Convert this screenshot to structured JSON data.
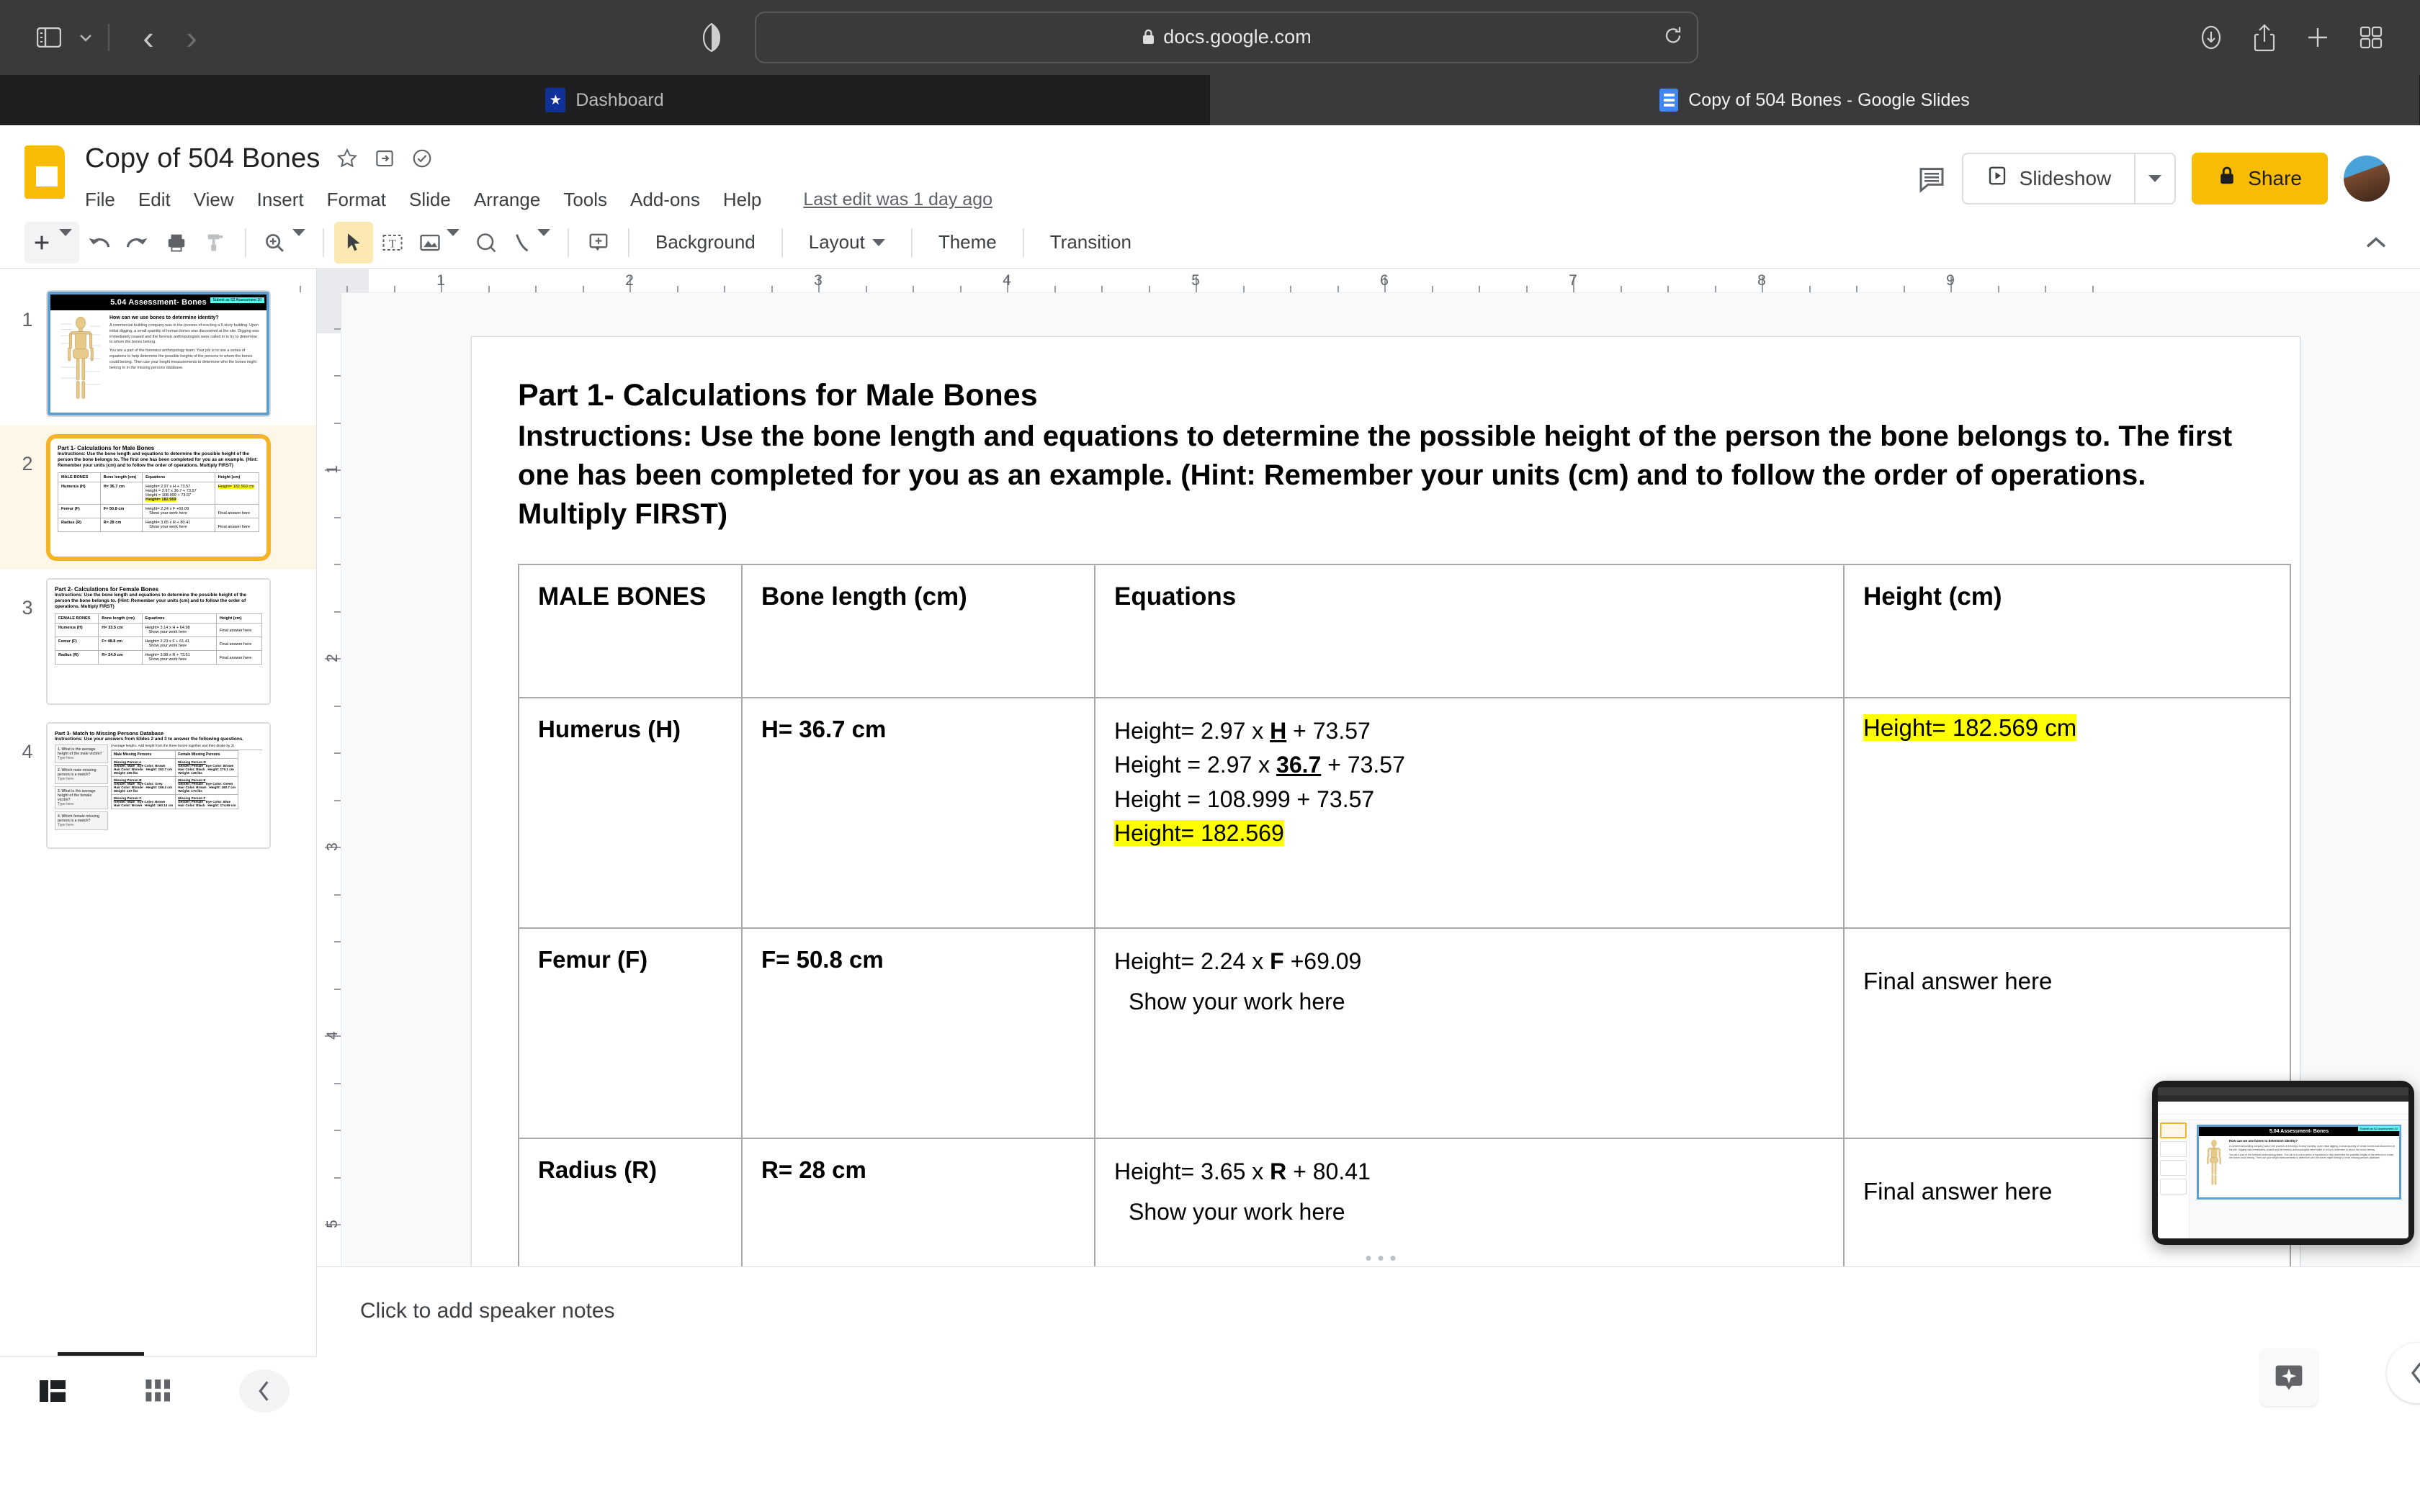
{
  "browser": {
    "url": "docs.google.com",
    "lock_icon": "lock-icon",
    "tabs": [
      {
        "label": "Dashboard",
        "favicon": "shield-star-icon",
        "active": false
      },
      {
        "label": "Copy of 504 Bones - Google Slides",
        "favicon": "google-slides-icon",
        "active": true
      }
    ],
    "toolbar_icons": [
      "sidebar-toggle-icon",
      "chevron-down-icon",
      "back-icon",
      "forward-icon",
      "shield-icon",
      "reload-icon",
      "downloads-icon",
      "share-icon",
      "new-tab-icon",
      "tab-overview-icon"
    ]
  },
  "app": {
    "title": "Copy of 504 Bones",
    "title_icons": [
      "star-icon",
      "move-to-folder-icon",
      "cloud-saved-icon"
    ],
    "menus": [
      "File",
      "Edit",
      "View",
      "Insert",
      "Format",
      "Slide",
      "Arrange",
      "Tools",
      "Add-ons",
      "Help"
    ],
    "last_edit": "Last edit was 1 day ago",
    "comments_label": "comment-history-icon",
    "slideshow_label": "Slideshow",
    "share_label": "Share",
    "share_lock_icon": "lock-icon",
    "avatar": "user-avatar",
    "accent_yellow": "#f9bc04",
    "selection_orange": "#f5b428",
    "highlight_yellow": "#ffff00"
  },
  "toolbar": {
    "new_slide": "new-slide-icon",
    "undo": "undo-icon",
    "redo": "redo-icon",
    "print": "print-icon",
    "paint_format": "paint-format-icon",
    "zoom": "zoom-icon",
    "select": "select-cursor-icon",
    "textbox": "text-box-icon",
    "image": "image-icon",
    "shape": "shape-icon",
    "line": "line-icon",
    "comment": "add-comment-icon",
    "background_label": "Background",
    "layout_label": "Layout",
    "theme_label": "Theme",
    "transition_label": "Transition",
    "collapse_icon": "chevron-up-icon"
  },
  "rulers": {
    "horizontal": [
      "1",
      "2",
      "3",
      "4",
      "5",
      "6",
      "7",
      "8",
      "9"
    ],
    "vertical": [
      "1",
      "2",
      "3",
      "4",
      "5"
    ]
  },
  "filmstrip": {
    "slides": [
      {
        "number": "1",
        "selected": false,
        "kind": "title",
        "badge": "Submit as S2 Assessment 10",
        "title": "5.04 Assessment- Bones",
        "question": "How can we use bones to determine identity?",
        "paragraphs": [
          "A commercial building company was in the process of erecting a 5-story building. Upon initial digging, a small quantity of human bones was discovered at the site. Digging was immediately ceased and the forensic anthropologists were called in to try to determine to whom the bones belong.",
          "You are a part of the forensics anthropology team. Your job is to use a series of equations to help determine the possible heights of the persons to whom the bones could belong. Then use your height measurements to determine who the bones might belong to in the missing persons database."
        ]
      },
      {
        "number": "2",
        "selected": true,
        "kind": "male",
        "title": "Part 1- Calculations for Male Bones",
        "instructions": "Instructions: Use the bone length and equations to determine the possible height of the person the bone belongs to. The first one has been completed for you as an example. (Hint: Remember your units (cm) and to follow the order of operations. Multiply FIRST)",
        "headers": [
          "MALE BONES",
          "Bone length (cm)",
          "Equations",
          "Height (cm)"
        ],
        "rows": [
          {
            "bone": "Humerus (H)",
            "length": "H= 36.7 cm",
            "eq_lines": [
              "Height= 2.97 x H + 73.57",
              "Height = 2.97 x 36.7 + 73.57",
              "Height = 108.999 + 73.57",
              "Height= 182.569"
            ],
            "height": "Height= 182.569 cm"
          },
          {
            "bone": "Femur (F)",
            "length": "F= 50.8 cm",
            "eq_lines": [
              "Height= 2.24 x F +69.09",
              "Show your work here"
            ],
            "height": "Final answer here"
          },
          {
            "bone": "Radius (R)",
            "length": "R= 28 cm",
            "eq_lines": [
              "Height= 3.65 x R + 80.41",
              "Show your work here"
            ],
            "height": "Final answer here"
          }
        ]
      },
      {
        "number": "3",
        "selected": false,
        "kind": "female",
        "title": "Part 2- Calculations for Female Bones",
        "instructions": "Instructions: Use the bone length and equations to determine the possible height of the person the bone belongs to. (Hint: Remember your units (cm) and to follow the order of operations. Multiply FIRST)",
        "headers": [
          "FEMALE BONES",
          "Bone length (cm)",
          "Equations",
          "Height (cm)"
        ],
        "rows": [
          {
            "bone": "Humerus (H)",
            "length": "H= 33.5 cm",
            "eq": "Height= 3.14 x H + 64.98",
            "work": "Show your work here",
            "height": "Final answer here"
          },
          {
            "bone": "Femur (F)",
            "length": "F= 48.8 cm",
            "eq": "Height= 2.23 x F + 61.41",
            "work": "Show your work here",
            "height": "Final answer here"
          },
          {
            "bone": "Radius (R)",
            "length": "R= 24.9 cm",
            "eq": "Height= 3.88 x R + 73.51",
            "work": "Show your work here",
            "height": "Final answer here"
          }
        ]
      },
      {
        "number": "4",
        "selected": false,
        "kind": "match",
        "title": "Part 3- Match to Missing Persons Database",
        "instructions": "Instructions: Use your answers from Slides 2 and 3 to answer the following questions.",
        "note": "(Average height= Add height from the three bones together and then divide by 3)",
        "questions": [
          {
            "q": "1. What is the average height of the male victim?",
            "a": "Type here"
          },
          {
            "q": "2. Which male missing person is a match?",
            "a": "Type here"
          },
          {
            "q": "3. What is the average height of the female victim?",
            "a": "Type here"
          },
          {
            "q": "4. Which female missing person is a match?",
            "a": "Type here"
          }
        ],
        "db_headers": [
          "Male Missing Persons",
          "Female Missing Persons"
        ],
        "persons": [
          {
            "male": "Missing Person A",
            "m_gender": "Gender: Male",
            "m_eye": "Eye Color: Brown",
            "m_hair": "Hair Color: Blonde",
            "m_height": "Height: 182.7 cm",
            "m_weight": "Weight: 205 lbs",
            "female": "Missing Person D",
            "f_gender": "Gender: Female",
            "f_eye": "Eye Color: Brown",
            "f_hair": "Hair Color: Black",
            "f_height": "Height: 170.1 cm",
            "f_weight": "Weight: 138 lbs"
          },
          {
            "male": "Missing Person B",
            "m_gender": "Gender: Male",
            "m_eye": "Eye Color: Grey",
            "m_hair": "Hair Color: Blonde",
            "m_height": "Height: 159.2 cm",
            "m_weight": "Weight: 137 lbs",
            "female": "Missing Person E",
            "f_gender": "Gender: Female",
            "f_eye": "Eye Color: Green",
            "f_hair": "Hair Color: Brown",
            "f_height": "Height: 190.7 cm",
            "f_weight": "Weight: 170 lbs"
          },
          {
            "male": "Missing Person C",
            "m_gender": "Gender: Male",
            "m_eye": "Eye Color: Brown",
            "m_hair": "Hair Color: Brown",
            "m_height": "Height: 193.14 cm",
            "m_weight": "",
            "female": "Missing Person F",
            "f_gender": "Gender: Female",
            "f_eye": "Eye Color: Blue",
            "f_hair": "Hair Color: Black",
            "f_height": "Height: 174.69 cm",
            "f_weight": ""
          }
        ]
      }
    ],
    "view_filmstrip_icon": "filmstrip-view-icon",
    "view_grid_icon": "grid-view-icon",
    "collapse_icon": "chevron-left-icon"
  },
  "slide": {
    "heading": "Part 1- Calculations for Male Bones",
    "instructions": "Instructions: Use the bone length and equations to determine the possible height of the person the bone belongs to. The first one has been completed for you as an example. (Hint: Remember your units (cm) and to follow the order of operations. Multiply FIRST)",
    "table": {
      "headers": [
        "MALE BONES",
        "Bone length (cm)",
        "Equations",
        "Height (cm)"
      ],
      "rows": [
        {
          "bone": "Humerus (H)",
          "length": "H= 36.7 cm",
          "eq1_pre": "Height= 2.97 x ",
          "eq1_var": "H",
          "eq1_post": " + 73.57",
          "eq2_pre": "Height = 2.97 x ",
          "eq2_var": "36.7",
          "eq2_post": " + 73.57",
          "eq3": "Height = 108.999 + 73.57",
          "eq4": "Height= 182.569",
          "height": "Height= 182.569 cm",
          "height_highlighted": true
        },
        {
          "bone": "Femur (F)",
          "length": "F= 50.8 cm",
          "eq1_pre": "Height= 2.24 x ",
          "eq1_var": "F",
          "eq1_post": " +69.09",
          "work": "Show your work here",
          "height": "Final answer here",
          "height_highlighted": false
        },
        {
          "bone": "Radius (R)",
          "length": "R= 28 cm",
          "eq1_pre": "Height= 3.65 x ",
          "eq1_var": "R",
          "eq1_post": " + 80.41",
          "work": "Show your work here",
          "height": "Final answer here",
          "height_highlighted": false
        }
      ]
    }
  },
  "notes": {
    "placeholder": "Click to add speaker notes",
    "sparkle_icon": "explore-sparkle-icon",
    "collapse_icon": "chevron-left-icon"
  },
  "pip": {
    "title": "5.04 Assessment- Bones",
    "badge": "Submit as S2 Assessment 10",
    "name": "screen-share-preview"
  }
}
